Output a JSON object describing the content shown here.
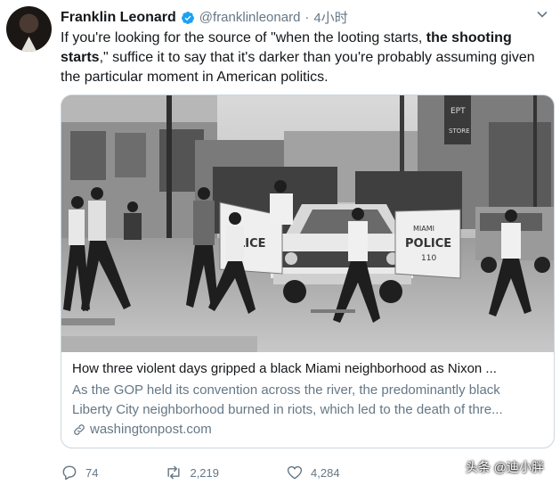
{
  "author": {
    "name": "Franklin Leonard",
    "handle": "@franklinleonard",
    "separator": "·",
    "time": "4小时"
  },
  "tweet": {
    "text_1": "If you're looking for the source of \"when the looting starts, ",
    "text_bold": "the shooting starts",
    "text_2": ",\" suffice it to say that it's darker than you're probably assuming given the particular moment in American politics."
  },
  "card": {
    "photo_police_label": "MIAMI POLICE 110",
    "photo_store_label": "EPT STORE",
    "title": "How three violent days gripped a black Miami neighborhood as Nixon ...",
    "desc_line1": "As the GOP held its convention across the river, the predominantly black",
    "desc_line2": "Liberty City neighborhood burned in riots, which led to the death of thre...",
    "domain": "washingtonpost.com"
  },
  "actions": {
    "replies": "74",
    "retweets": "2,219",
    "likes": "4,284"
  },
  "watermark": "头条 @迪小胖",
  "colors": {
    "text": "#14171a",
    "muted": "#657786",
    "verified": "#1da1f2",
    "border": "#ccd6dd"
  }
}
